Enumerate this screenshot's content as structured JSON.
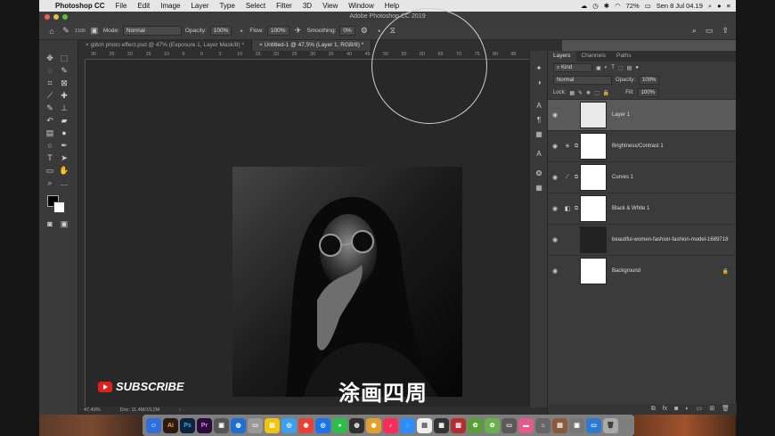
{
  "menubar": {
    "app_name": "Photoshop CC",
    "items": [
      "File",
      "Edit",
      "Image",
      "Layer",
      "Type",
      "Select",
      "Filter",
      "3D",
      "View",
      "Window",
      "Help"
    ],
    "battery": "72%",
    "datetime": "Sen 8 Jul 04.19"
  },
  "window": {
    "title": "Adobe Photoshop CC 2019"
  },
  "options_bar": {
    "brush_size": "1100",
    "mode_label": "Mode:",
    "mode_value": "Normal",
    "opacity_label": "Opacity:",
    "opacity_value": "100%",
    "flow_label": "Flow:",
    "flow_value": "100%",
    "smoothing_label": "Smoothing:",
    "smoothing_value": "0%"
  },
  "tabs": [
    {
      "label": "glitch photo effect.psd @ 47% (Exposure 1, Layer Mask/8) *"
    },
    {
      "label": "Untitled-1 @ 47,5% (Layer 1, RGB/8) *"
    }
  ],
  "ruler": {
    "ticks": [
      "30",
      "25",
      "20",
      "15",
      "10",
      "5",
      "0",
      "5",
      "10",
      "15",
      "20",
      "25",
      "30",
      "35",
      "40",
      "45",
      "50",
      "55",
      "60",
      "65",
      "70",
      "75",
      "80",
      "85",
      "90",
      "95"
    ]
  },
  "status": {
    "zoom": "47,49%",
    "doc": "Doc: 11,4M/19,2M"
  },
  "panel": {
    "tabs": [
      "Layers",
      "Channels",
      "Paths"
    ],
    "kind_label": "Kind",
    "blend_mode": "Normal",
    "opacity_label": "Opacity:",
    "opacity_value": "100%",
    "lock_label": "Lock:",
    "fill_label": "Fill:",
    "fill_value": "100%",
    "layers": [
      {
        "name": "Layer 1"
      },
      {
        "name": "Brightness/Contrast 1"
      },
      {
        "name": "Curves 1"
      },
      {
        "name": "Black & White 1"
      },
      {
        "name": "beautiful-women-fashion-fashion-model-1689718"
      },
      {
        "name": "Background"
      }
    ]
  },
  "overlay": {
    "subscribe": "SUBSCRIBE",
    "caption": "涂画四周"
  }
}
